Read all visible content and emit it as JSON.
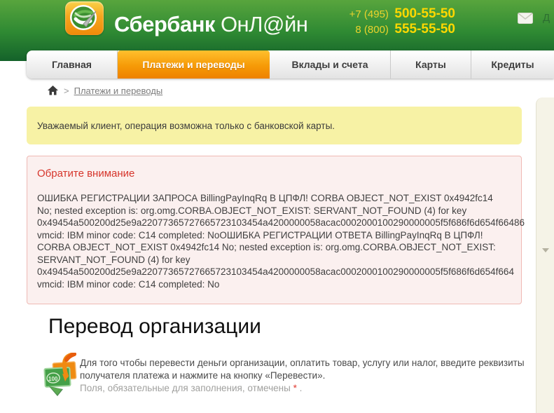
{
  "header": {
    "brand_bold": "Сбербанк",
    "brand_light": "ОнЛ@йн",
    "phone1_prefix": "+7 (495)",
    "phone1_number": "500-55-50",
    "phone2_prefix": "8 (800)",
    "phone2_number": "555-55-50",
    "mail_label": "Д"
  },
  "nav": {
    "tabs": [
      {
        "label": "Главная",
        "active": false
      },
      {
        "label": "Платежи и переводы",
        "active": true
      },
      {
        "label": "Вклады и счета",
        "active": false
      },
      {
        "label": "Карты",
        "active": false
      },
      {
        "label": "Кредиты",
        "active": false
      }
    ]
  },
  "breadcrumb": {
    "separator": ">",
    "link": "Платежи и переводы"
  },
  "notice": {
    "text": "Уважаемый клиент, операция возможна только с банковской карты."
  },
  "error": {
    "title": "Обратите внимание",
    "lines": [
      "ОШИБКА РЕГИСТРАЦИИ ЗАПРОСА BillingPayInqRq В ЦПФЛ! CORBA OBJECT_NOT_EXIST 0x4942fc14",
      "No; nested exception is: org.omg.CORBA.OBJECT_NOT_EXIST: SERVANT_NOT_FOUND (4) for key",
      "0x49454a500200d25e9a22077365727665723103454a4200000058acac0002000100290000005f5f686f6d654f66486",
      "vmcid: IBM minor code: C14 completed: NoОШИБКА РЕГИСТРАЦИИ ОТВЕТА BillingPayInqRq В ЦПФЛ!",
      "CORBA OBJECT_NOT_EXIST 0x4942fc14 No; nested exception is: org.omg.CORBA.OBJECT_NOT_EXIST:",
      "SERVANT_NOT_FOUND (4) for key",
      "0x49454a500200d25e9a22077365727665723103454a4200000058acac0002000100290000005f5f686f6d654f664",
      "vmcid: IBM minor code: C14 completed: No"
    ]
  },
  "section": {
    "title": "Перевод организации",
    "description_line1": "Для того чтобы перевести деньги организации, оплатить товар, услугу или налог, введите реквизиты",
    "description_line2": "получателя платежа и нажмите на кнопку «Перевести».",
    "required_note": "Поля, обязательные для заполнения, отмечены ",
    "required_star": "*",
    "required_period": " ."
  },
  "icons": {
    "logo": "sberbank-logo",
    "mail": "envelope",
    "home": "home",
    "money": "money-transfer-banknotes",
    "money_label": "100",
    "sidebar_arrow": "chevron-down"
  },
  "colors": {
    "header_green_top": "#58a53d",
    "header_green_bottom": "#14622a",
    "active_tab_orange": "#f69a07",
    "phone_yellow": "#ffd800",
    "notice_bg": "#f7f2a5",
    "error_bg": "#fbf0ef",
    "error_border": "#efb9b4",
    "error_red": "#d6352b"
  }
}
